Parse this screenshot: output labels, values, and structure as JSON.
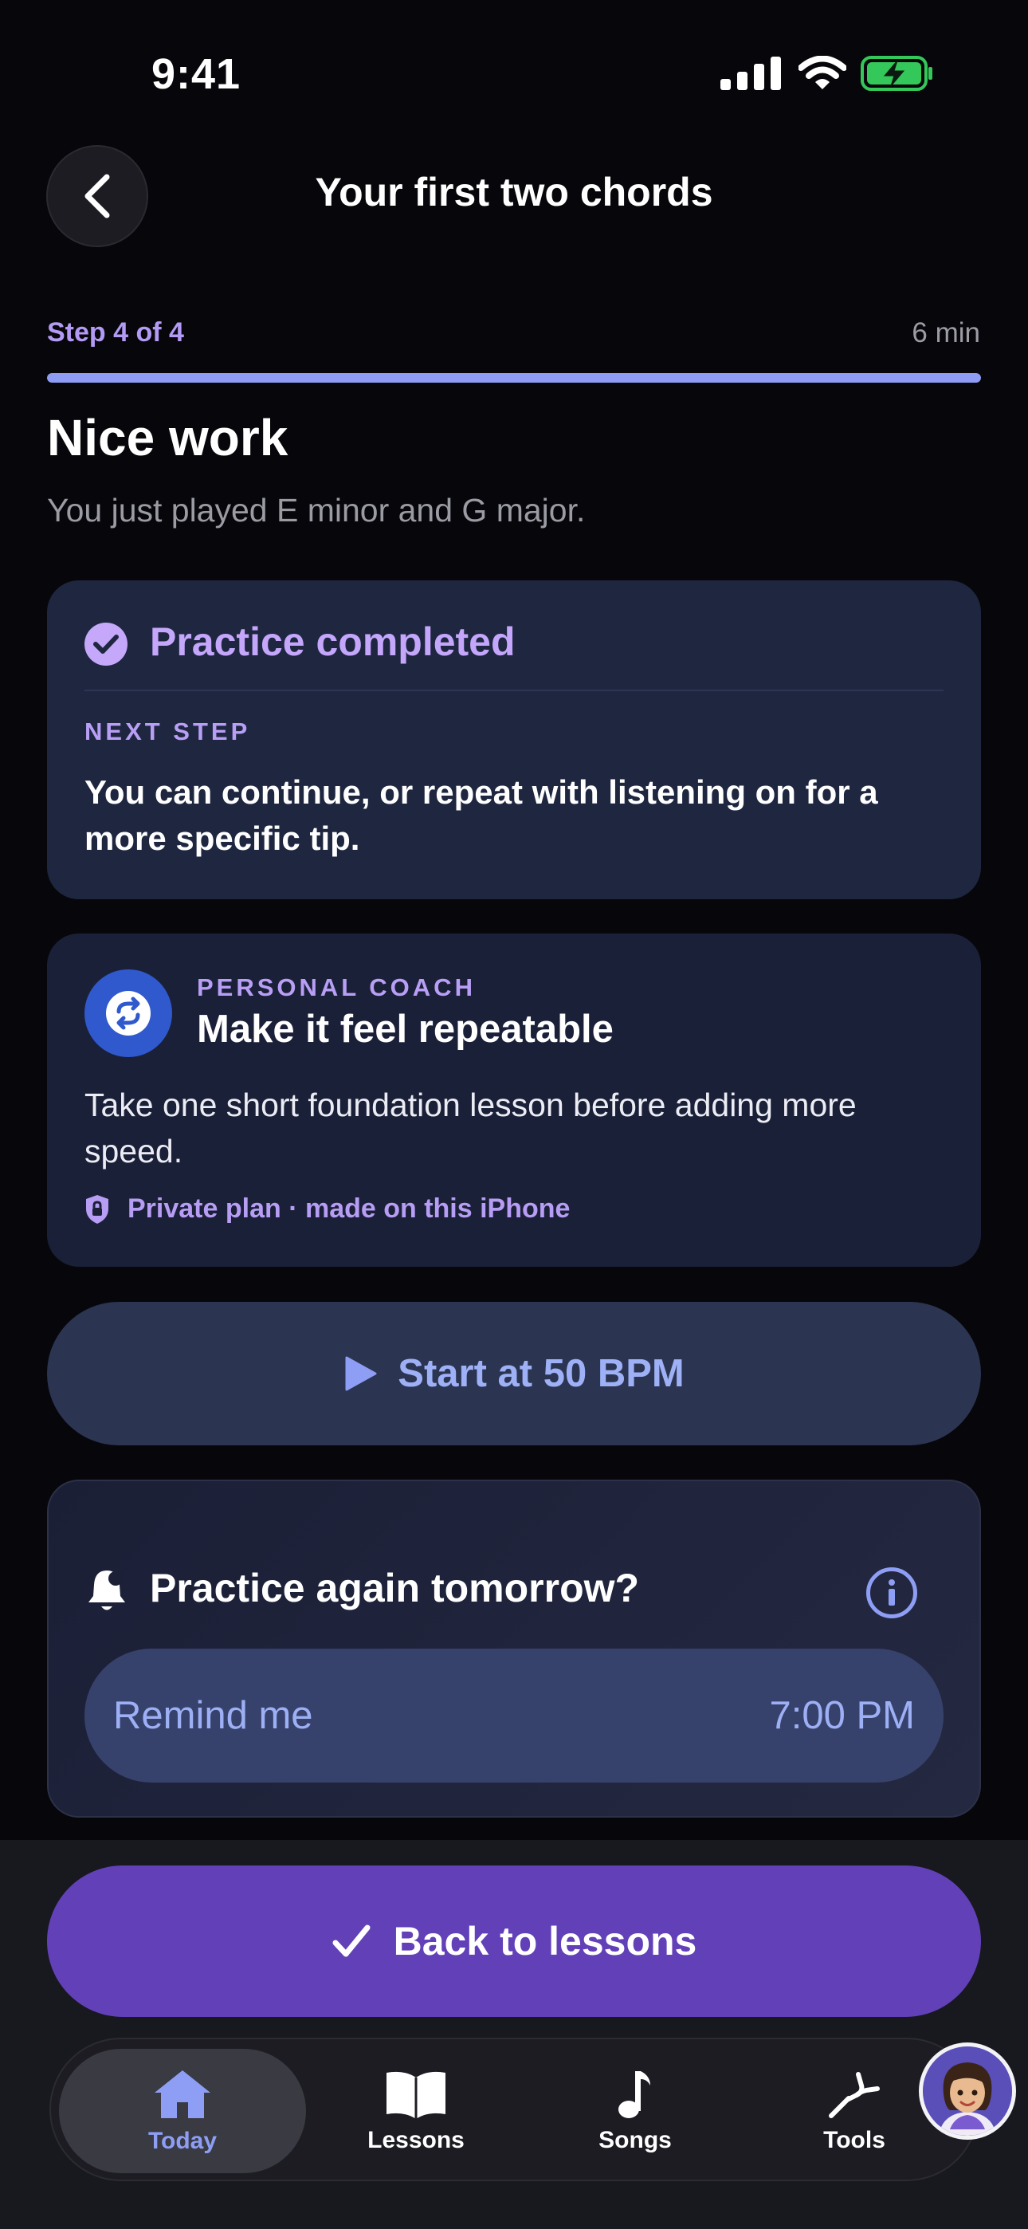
{
  "status_bar": {
    "time": "9:41"
  },
  "header": {
    "title": "Your first two chords"
  },
  "progress": {
    "step_label": "Step 4 of 4",
    "duration": "6 min",
    "fraction": 1.0
  },
  "intro": {
    "title": "Nice work",
    "subtitle": "You just played E minor and G major."
  },
  "completion_card": {
    "title": "Practice completed",
    "section_label": "NEXT STEP",
    "body": "You can continue, or repeat with listening on for a more specific tip."
  },
  "coach_card": {
    "label": "PERSONAL COACH",
    "title": "Make it feel repeatable",
    "body": "Take one short foundation lesson before adding more speed.",
    "privacy_note": "Private plan · made on this iPhone"
  },
  "start_button": {
    "label": "Start at 50 BPM"
  },
  "reminder": {
    "title": "Practice again tomorrow?",
    "pill_label": "Remind me",
    "time": "7:00 PM"
  },
  "primary_action": {
    "label": "Back to lessons"
  },
  "tabbar": {
    "tabs": [
      {
        "label": "Today",
        "icon": "home-icon",
        "active": true
      },
      {
        "label": "Lessons",
        "icon": "book-icon",
        "active": false
      },
      {
        "label": "Songs",
        "icon": "music-note-icon",
        "active": false
      },
      {
        "label": "Tools",
        "icon": "tuning-fork-icon",
        "active": false
      }
    ]
  },
  "colors": {
    "accent_purple": "#c4a6fb",
    "accent_blue": "#8d9ef4",
    "primary_button": "#6240b8",
    "coach_icon_bg": "#2f59cc",
    "battery_green": "#34c759"
  }
}
